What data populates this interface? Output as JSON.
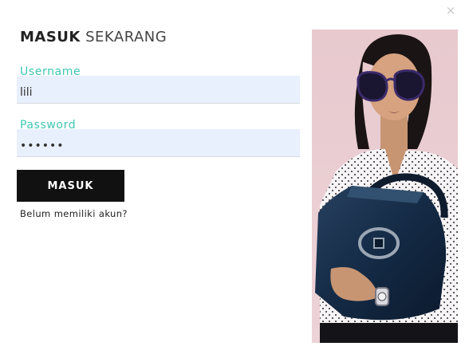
{
  "modal": {
    "close_icon": "×",
    "title_bold": "MASUK",
    "title_light": "SEKARANG"
  },
  "form": {
    "username": {
      "label": "Username",
      "value": "lili"
    },
    "password": {
      "label": "Password",
      "value": "••••••"
    },
    "submit_label": "MASUK",
    "register_link": "Belum memiliki akun?"
  },
  "colors": {
    "label_accent": "#3ec6b4",
    "input_autofill_bg": "#e8f0fe",
    "button_bg": "#111111",
    "photo_bg": "#e9ccd2"
  },
  "image": {
    "subject": "woman in sunglasses holding navy handbag"
  }
}
